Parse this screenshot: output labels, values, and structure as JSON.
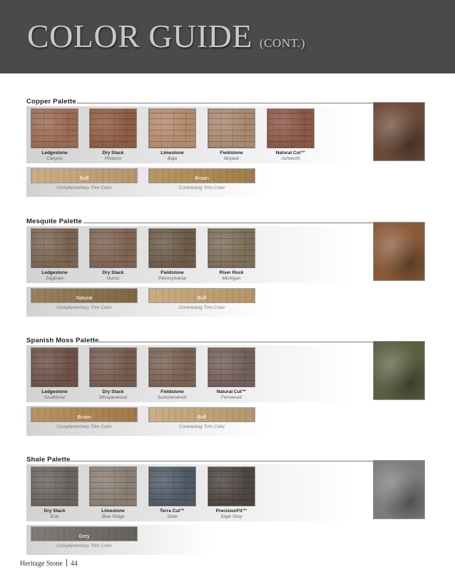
{
  "header": {
    "title": "COLOR GUIDE",
    "subtitle": "(CONT.)"
  },
  "palettes": [
    {
      "title": "Copper Palette",
      "stones": [
        {
          "name": "Ledgestone",
          "color": "Canyon",
          "swatch": "#9a6a52"
        },
        {
          "name": "Dry Stack",
          "color": "Phoenix",
          "swatch": "#8e5c44"
        },
        {
          "name": "Limestone",
          "color": "Baja",
          "swatch": "#b48a6c"
        },
        {
          "name": "Fieldstone",
          "color": "Mojave",
          "swatch": "#a88870"
        },
        {
          "name": "Natural Cut™",
          "color": "Ashworth",
          "swatch": "#8a5848"
        }
      ],
      "photo": "#6c4a38",
      "trims": [
        {
          "name": "Buff",
          "caption": "Complementary Trim Color",
          "swatch": "#c8a274"
        },
        {
          "name": "Brown",
          "caption": "Contrasting Trim Color",
          "swatch": "#b08850"
        }
      ]
    },
    {
      "title": "Mesquite Palette",
      "stones": [
        {
          "name": "Ledgestone",
          "color": "Saginaw",
          "swatch": "#7a6450"
        },
        {
          "name": "Dry Stack",
          "color": "Huron",
          "swatch": "#7e6452"
        },
        {
          "name": "Fieldstone",
          "color": "Pennsylvania",
          "swatch": "#6c5c48"
        },
        {
          "name": "River Rock",
          "color": "Michigan",
          "swatch": "#7e6e58"
        }
      ],
      "photo": "#8a5a38",
      "trims": [
        {
          "name": "Natural",
          "caption": "Complementary Trim Color",
          "swatch": "#8a7046"
        },
        {
          "name": "Buff",
          "caption": "Contrasting Trim Color",
          "swatch": "#c4a270"
        }
      ]
    },
    {
      "title": "Spanish Moss Palette",
      "stones": [
        {
          "name": "Ledgestone",
          "color": "Southbriar",
          "swatch": "#6e5248"
        },
        {
          "name": "Dry Stack",
          "color": "Whisperwood",
          "swatch": "#765c50"
        },
        {
          "name": "Fieldstone",
          "color": "Summerwinds",
          "swatch": "#7a6254"
        },
        {
          "name": "Natural Cut™",
          "color": "Fernwood",
          "swatch": "#74605a"
        }
      ],
      "photo": "#5a6040",
      "trims": [
        {
          "name": "Brown",
          "caption": "Complementary Trim Color",
          "swatch": "#b08450"
        },
        {
          "name": "Buff",
          "caption": "Contrasting Trim Color",
          "swatch": "#c4a474"
        }
      ]
    },
    {
      "title": "Shale Palette",
      "stones": [
        {
          "name": "Dry Stack",
          "color": "Erie",
          "swatch": "#6a6460"
        },
        {
          "name": "Limestone",
          "color": "Blue Ridge",
          "swatch": "#8a7e74"
        },
        {
          "name": "Terra Cut™",
          "color": "Slate",
          "swatch": "#505a66"
        },
        {
          "name": "PrecisionFit™",
          "color": "Sage Grey",
          "swatch": "#4e4642"
        }
      ],
      "photo": "#7c7c7c",
      "trims": [
        {
          "name": "Grey",
          "caption": "Complementary Trim Color",
          "swatch": "#6e6a64"
        }
      ]
    }
  ],
  "footer": {
    "brand": "Heritage Stone",
    "page": "44"
  }
}
